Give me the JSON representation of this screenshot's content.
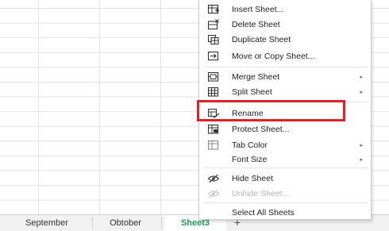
{
  "menu": {
    "items": [
      {
        "name": "insert-sheet",
        "label": "Insert Sheet...",
        "icon": "insert-sheet-icon"
      },
      {
        "name": "delete-sheet",
        "label": "Delete Sheet",
        "icon": "delete-sheet-icon"
      },
      {
        "name": "duplicate-sheet",
        "label": "Duplicate Sheet",
        "icon": "duplicate-sheet-icon"
      },
      {
        "name": "move-copy-sheet",
        "label": "Move or Copy Sheet...",
        "icon": "move-sheet-icon"
      },
      {
        "name": "merge-sheet",
        "label": "Merge Sheet",
        "icon": "merge-sheet-icon",
        "submenu": true
      },
      {
        "name": "split-sheet",
        "label": "Split Sheet",
        "icon": "split-sheet-icon",
        "submenu": true
      },
      {
        "name": "rename",
        "label": "Rename",
        "icon": "rename-icon"
      },
      {
        "name": "protect-sheet",
        "label": "Protect Sheet...",
        "icon": "protect-sheet-icon"
      },
      {
        "name": "tab-color",
        "label": "Tab Color",
        "icon": "tab-color-icon",
        "submenu": true
      },
      {
        "name": "font-size",
        "label": "Font Size",
        "icon": "",
        "submenu": true
      },
      {
        "name": "hide-sheet",
        "label": "Hide Sheet",
        "icon": "hide-sheet-icon"
      },
      {
        "name": "unhide-sheet",
        "label": "Unhide Sheet...",
        "icon": "unhide-sheet-icon",
        "disabled": true
      },
      {
        "name": "select-all-sheets",
        "label": "Select All Sheets",
        "icon": ""
      }
    ],
    "submenu_arrow": "▸"
  },
  "tabs": {
    "items": [
      {
        "label": "September",
        "active": false
      },
      {
        "label": "Obtober",
        "active": false
      },
      {
        "label": "Sheet3",
        "active": true
      }
    ],
    "add_label": "+"
  },
  "colors": {
    "highlight": "#d9222a",
    "active_tab": "#1e9c5a"
  }
}
